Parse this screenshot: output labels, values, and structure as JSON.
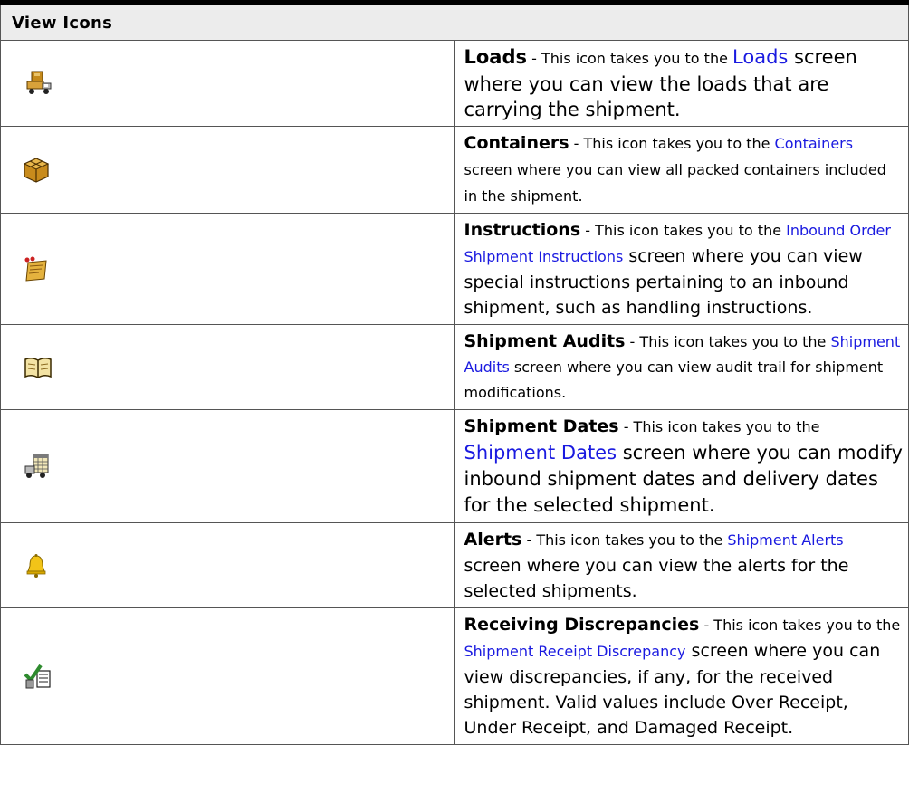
{
  "table": {
    "title": "View Icons",
    "rows": [
      {
        "icon": "loads-truck-icon",
        "name": "Loads",
        "pre": " - This icon takes you to the ",
        "link": "Loads",
        "post": " screen where you can view the loads that are carrying the shipment."
      },
      {
        "icon": "containers-box-icon",
        "name": "Containers",
        "pre": " - This icon takes you to the ",
        "link": "Containers",
        "post": " screen where you can view all packed containers included in the shipment."
      },
      {
        "icon": "instructions-note-icon",
        "name": "Instructions",
        "pre": " - This icon takes you to the ",
        "link": "Inbound Order Shipment Instructions",
        "post": " screen where you can view special instructions pertaining to an inbound shipment, such as handling instructions."
      },
      {
        "icon": "audits-book-icon",
        "name": "Shipment Audits",
        "pre": " - This icon takes you to the ",
        "link": "Shipment Audits",
        "post": " screen where you can view audit trail for shipment modifications."
      },
      {
        "icon": "dates-calendar-truck-icon",
        "name": "Shipment Dates",
        "pre": " - This icon takes you to the ",
        "link": "Shipment Dates",
        "post": " screen where you can modify inbound shipment dates and delivery dates for the selected shipment."
      },
      {
        "icon": "alerts-bell-icon",
        "name": "Alerts",
        "pre": " - This icon takes you to the ",
        "link": "Shipment Alerts",
        "post": " screen where you can view the alerts for the selected shipments."
      },
      {
        "icon": "discrepancies-check-list-icon",
        "name": "Receiving Discrepancies",
        "pre": " - This icon takes you to the ",
        "link": "Shipment Receipt Discrepancy",
        "post": " screen where you can view discrepancies, if any, for the received shipment. Valid values include Over Receipt, Under Receipt, and Damaged Receipt."
      }
    ]
  }
}
